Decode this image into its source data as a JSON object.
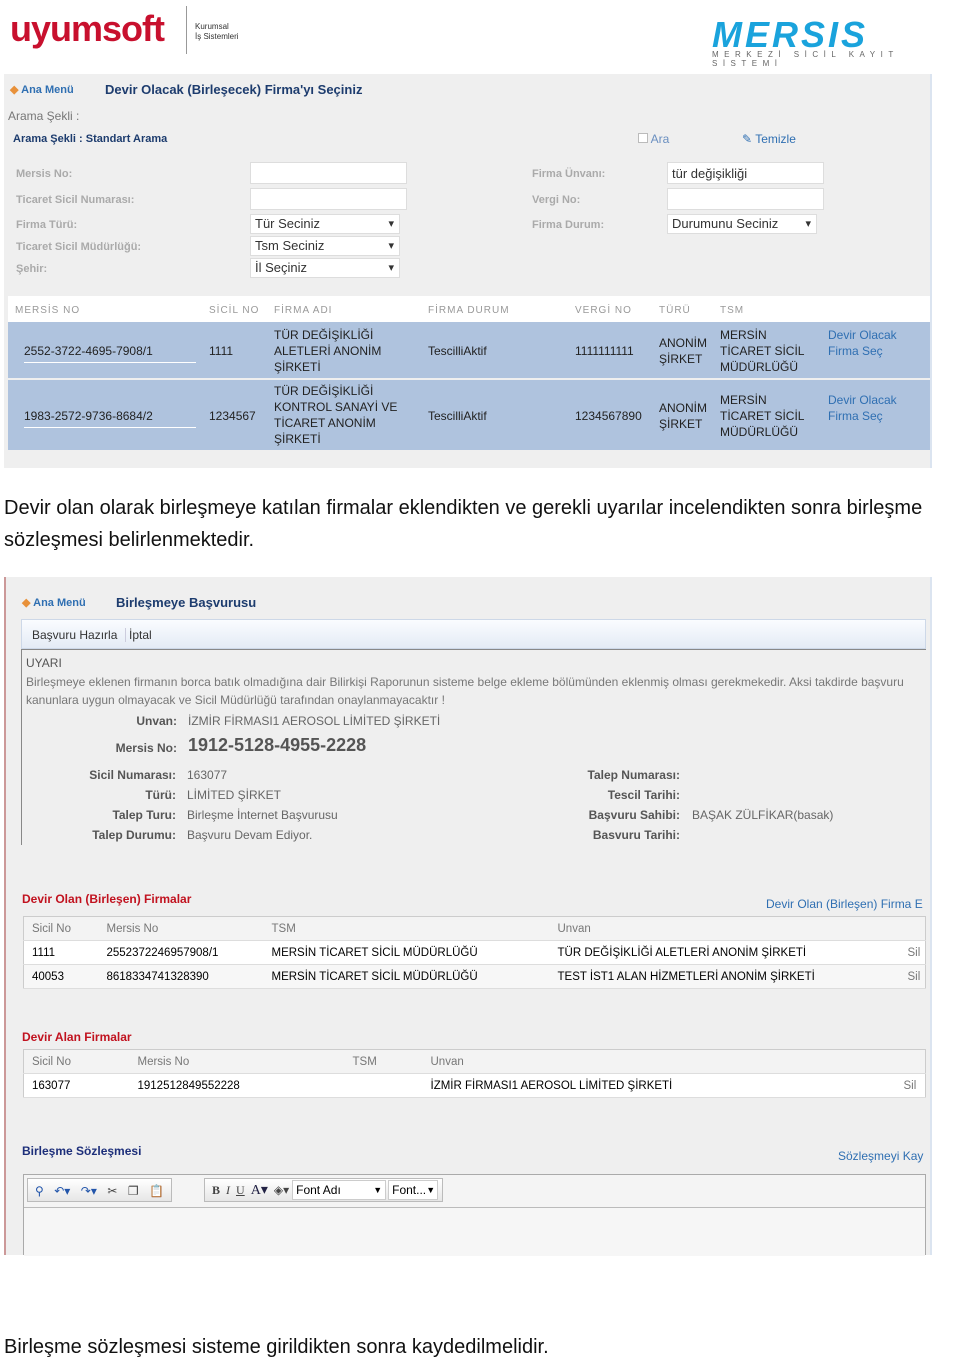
{
  "header": {
    "left_logo": "uyumsoft",
    "left_logo_sub": [
      "Kurumsal",
      "İş Sistemleri"
    ],
    "right_logo": "MERSIS",
    "right_logo_sub": "MERKEZİ SİCİL KAYIT SİSTEMİ"
  },
  "screen1": {
    "ana_menu": "Ana Menü",
    "title": "Devir Olacak (Birleşecek) Firma'yı Seçiniz",
    "arama_sekli": "Arama Şekli :",
    "arama_sekli_value": "Arama Şekli : Standart Arama",
    "ara": "Ara",
    "temizle": "Temizle",
    "fields_left": [
      {
        "label": "Mersis No:",
        "value": ""
      },
      {
        "label": "Ticaret Sicil Numarası:",
        "value": ""
      },
      {
        "label": "Firma Türü:",
        "value": "Tür Seciniz"
      },
      {
        "label": "Ticaret Sicil Müdürlüğü:",
        "value": "Tsm Seciniz"
      },
      {
        "label": "Şehir:",
        "value": "İl Seçiniz"
      }
    ],
    "fields_right": [
      {
        "label": "Firma Ünvanı:",
        "value": "tür değişikliği"
      },
      {
        "label": "Vergi No:",
        "value": ""
      },
      {
        "label": "Firma Durum:",
        "value": "Durumunu Seciniz"
      }
    ],
    "columns": [
      "MERSİS NO",
      "SİCİL NO",
      "FİRMA ADI",
      "FİRMA DURUM",
      "VERGİ NO",
      "TÜRÜ",
      "TSM"
    ],
    "rows": [
      {
        "mersis": "2552-3722-4695-7908/1",
        "sicil": "1111",
        "firma": "TÜR DEĞİŞİKLİĞİ ALETLERİ ANONİM ŞİRKETİ",
        "durum": "TescilliAktif",
        "vergi": "1111111111",
        "tur": "ANONİM ŞİRKET",
        "tsm": "MERSİN TİCARET SİCİL MÜDÜRLÜĞÜ",
        "action": "Devir Olacak Firma Seç"
      },
      {
        "mersis": "1983-2572-9736-8684/2",
        "sicil": "1234567",
        "firma": "TÜR DEĞİŞİKLİĞİ KONTROL SANAYİ VE TİCARET ANONİM ŞİRKETİ",
        "durum": "TescilliAktif",
        "vergi": "1234567890",
        "tur": "ANONİM ŞİRKET",
        "tsm": "MERSİN TİCARET SİCİL MÜDÜRLÜĞÜ",
        "action": "Devir Olacak Firma Seç"
      }
    ]
  },
  "paragraph1": "Devir olan olarak birleşmeye katılan firmalar eklendikten ve gerekli uyarılar incelendikten sonra birleşme sözleşmesi belirlenmektedir.",
  "screen2": {
    "ana_menu": "Ana Menü",
    "title": "Birleşmeye Başvurusu",
    "tabs": [
      "Başvuru Hazırla",
      "İptal"
    ],
    "uyari": "UYARI",
    "uyari_text": "Birleşmeye eklenen firmanın borca batık olmadığına dair Bilirkişi Raporunun sisteme belge ekleme bölümünden eklenmiş olması gerekmekedir. Aksi takdirde başvuru kanunlara uygun olmayacak ve Sicil Müdürlüğü tarafından onaylanmayacaktır !",
    "unvan_label": "Unvan:",
    "unvan": "İZMİR FİRMASI1 AEROSOL LİMİTED ŞİRKETİ",
    "mersis_label": "Mersis No:",
    "mersis": "1912-5128-4955-2228",
    "left_info": [
      {
        "label": "Sicil Numarası:",
        "value": "163077"
      },
      {
        "label": "Türü:",
        "value": "LİMİTED ŞİRKET"
      },
      {
        "label": "Talep Turu:",
        "value": "Birleşme İnternet Başvurusu"
      },
      {
        "label": "Talep Durumu:",
        "value": "Başvuru Devam Ediyor."
      }
    ],
    "right_info": [
      {
        "label": "Talep Numarası:",
        "value": ""
      },
      {
        "label": "Tescil Tarihi:",
        "value": ""
      },
      {
        "label": "Başvuru Sahibi:",
        "value": "BAŞAK ZÜLFİKAR(basak)"
      },
      {
        "label": "Basvuru Tarihi:",
        "value": ""
      }
    ],
    "devir_olan": {
      "title": "Devir Olan (Birleşen) Firmalar",
      "link": "Devir Olan (Birleşen) Firma E",
      "columns": [
        "Sicil No",
        "Mersis No",
        "TSM",
        "Unvan"
      ],
      "rows": [
        {
          "sicil": "1111",
          "mersis": "2552372246957908/1",
          "tsm": "MERSİN TİCARET SİCİL MÜDÜRLÜĞÜ",
          "unvan": "TÜR DEĞİŞİKLİĞİ ALETLERİ ANONİM ŞİRKETİ",
          "action": "Sil"
        },
        {
          "sicil": "40053",
          "mersis": "8618334741328390",
          "tsm": "MERSİN TİCARET SİCİL MÜDÜRLÜĞÜ",
          "unvan": "TEST İST1 ALAN HİZMETLERİ ANONİM ŞİRKETİ",
          "action": "Sil"
        }
      ]
    },
    "devir_alan": {
      "title": "Devir Alan Firmalar",
      "columns": [
        "Sicil No",
        "Mersis No",
        "TSM",
        "Unvan"
      ],
      "rows": [
        {
          "sicil": "163077",
          "mersis": "1912512849552228",
          "tsm": "",
          "unvan": "İZMİR FİRMASI1 AEROSOL LİMİTED ŞİRKETİ",
          "action": "Sil"
        }
      ]
    },
    "sozlesme": {
      "title": "Birleşme Sözleşmesi",
      "save": "Sözleşmeyi Kay",
      "toolbar": {
        "bold": "B",
        "italic": "I",
        "underline": "U",
        "font_color": "A",
        "font_name": "Font Adı",
        "font_size": "Font..."
      }
    }
  },
  "paragraph2": "Birleşme sözleşmesi sisteme girildikten sonra kaydedilmelidir."
}
